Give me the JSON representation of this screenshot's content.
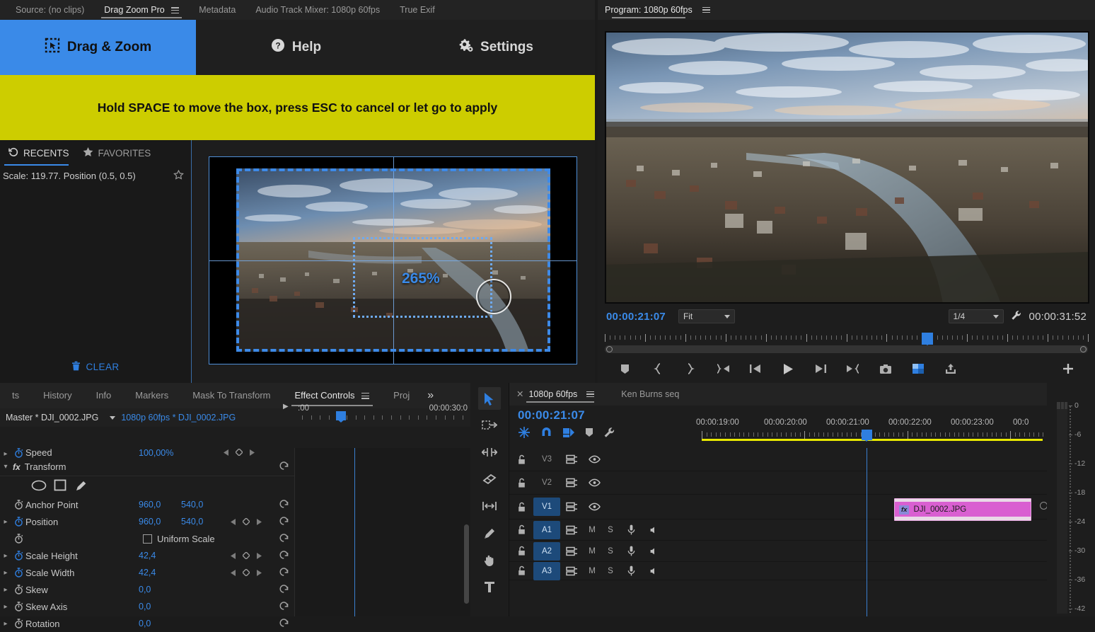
{
  "extension": {
    "tabs": [
      {
        "label": "Source: (no clips)",
        "active": false,
        "menu": false
      },
      {
        "label": "Drag Zoom Pro",
        "active": true,
        "menu": true
      },
      {
        "label": "Metadata",
        "active": false,
        "menu": false
      },
      {
        "label": "Audio Track Mixer: 1080p 60fps",
        "active": false,
        "menu": false
      },
      {
        "label": "True Exif",
        "active": false,
        "menu": false
      }
    ],
    "nav": [
      {
        "label": "Drag & Zoom",
        "icon": "drag-zoom-icon",
        "primary": true
      },
      {
        "label": "Help",
        "icon": "help-icon",
        "primary": false
      },
      {
        "label": "Settings",
        "icon": "gear-icon",
        "primary": false
      }
    ],
    "banner": "Hold SPACE to move the box, press ESC to cancel or let go to apply",
    "recents": {
      "tabs": [
        {
          "label": "RECENTS",
          "icon": "history-icon",
          "active": true
        },
        {
          "label": "FAVORITES",
          "icon": "star-icon",
          "active": false
        }
      ],
      "items": [
        {
          "text": "Scale: 119.77. Position (0.5, 0.5)",
          "favorite_icon": "star-outline-icon"
        }
      ],
      "clear_label": "CLEAR",
      "clear_icon": "trash-icon"
    },
    "stage": {
      "zoom_label": "265%",
      "cursor_icon": "arrow-cursor-icon"
    }
  },
  "program": {
    "tab_label": "Program: 1080p 60fps",
    "menu_icon": "hamburger-icon",
    "current_time": "00:00:21:07",
    "fit_value": "Fit",
    "quality_value": "1/4",
    "wrench_icon": "wrench-icon",
    "duration": "00:00:31:52",
    "buttons": [
      {
        "name": "add-marker-button",
        "icon": "marker-icon"
      },
      {
        "name": "mark-in-button",
        "icon": "brace-left-icon"
      },
      {
        "name": "mark-out-button",
        "icon": "brace-right-icon"
      },
      {
        "name": "go-to-in-button",
        "icon": "go-to-in-icon"
      },
      {
        "name": "step-back-button",
        "icon": "step-back-icon"
      },
      {
        "name": "play-stop-button",
        "icon": "play-icon"
      },
      {
        "name": "step-forward-button",
        "icon": "step-forward-icon"
      },
      {
        "name": "go-to-out-button",
        "icon": "go-to-out-icon"
      },
      {
        "name": "export-frame-button",
        "icon": "camera-icon"
      },
      {
        "name": "comparison-view-button",
        "icon": "comparison-icon"
      },
      {
        "name": "export-button",
        "icon": "export-icon"
      },
      {
        "name": "button-editor-button",
        "icon": "plus-icon"
      }
    ]
  },
  "effect_controls": {
    "tabs": [
      {
        "label": "ts",
        "active": false
      },
      {
        "label": "History",
        "active": false
      },
      {
        "label": "Info",
        "active": false
      },
      {
        "label": "Markers",
        "active": false
      },
      {
        "label": "Mask To Transform",
        "active": false
      },
      {
        "label": "Effect Controls",
        "active": true,
        "menu": true
      },
      {
        "label": "Proj",
        "active": false
      }
    ],
    "overflow_icon": "chevron-double-right-icon",
    "master_label": "Master * DJI_0002.JPG",
    "sequence_label": "1080p 60fps * DJI_0002.JPG",
    "ruler_left": ":00",
    "ruler_right": "00:00:30:0",
    "effect_title": "Transform",
    "effect_fx_icon": "fx-icon",
    "shape_tools": [
      {
        "name": "ellipse-mask-tool",
        "icon": "ellipse-icon"
      },
      {
        "name": "rectangle-mask-tool",
        "icon": "rectangle-icon"
      },
      {
        "name": "pen-mask-tool",
        "icon": "pen-icon"
      }
    ],
    "properties": [
      {
        "label": "Speed",
        "value": "100,00%",
        "expandable": true,
        "keyframed": false,
        "nav": true,
        "partial": true
      },
      {
        "label": "Anchor Point",
        "value": "960,0",
        "value2": "540,0",
        "expandable": false,
        "keyframed": false,
        "nav": false
      },
      {
        "label": "Position",
        "value": "960,0",
        "value2": "540,0",
        "expandable": true,
        "keyframed": true,
        "nav": true
      },
      {
        "label": "Uniform Scale",
        "value": "",
        "checkbox": true,
        "expandable": false,
        "keyframed": false,
        "nav": false
      },
      {
        "label": "Scale Height",
        "value": "42,4",
        "expandable": true,
        "keyframed": true,
        "nav": true
      },
      {
        "label": "Scale Width",
        "value": "42,4",
        "expandable": true,
        "keyframed": true,
        "nav": true
      },
      {
        "label": "Skew",
        "value": "0,0",
        "expandable": true,
        "keyframed": false,
        "nav": false
      },
      {
        "label": "Skew Axis",
        "value": "0,0",
        "expandable": true,
        "keyframed": false,
        "nav": false
      },
      {
        "label": "Rotation",
        "value": "0,0",
        "expandable": true,
        "keyframed": false,
        "nav": false
      }
    ]
  },
  "tools": [
    {
      "name": "selection-tool",
      "icon": "arrow-cursor-icon",
      "active": true
    },
    {
      "name": "track-select-forward-tool",
      "icon": "track-select-icon",
      "active": false
    },
    {
      "name": "ripple-edit-tool",
      "icon": "ripple-edit-icon",
      "active": false
    },
    {
      "name": "rolling-edit-tool",
      "icon": "razor-icon",
      "active": false
    },
    {
      "name": "slip-tool",
      "icon": "slip-icon",
      "active": false
    },
    {
      "name": "pen-tool",
      "icon": "pen-icon",
      "active": false
    },
    {
      "name": "hand-tool",
      "icon": "hand-icon",
      "active": false
    },
    {
      "name": "type-tool",
      "icon": "type-icon",
      "active": false
    }
  ],
  "timeline": {
    "tabs": [
      {
        "label": "1080p 60fps",
        "active": true,
        "close": true,
        "menu": true
      },
      {
        "label": "Ken Burns seq",
        "active": false
      }
    ],
    "current_time": "00:00:21:07",
    "header_icons": [
      {
        "name": "nest-sequence-button",
        "icon": "nest-icon",
        "on": true
      },
      {
        "name": "snap-button",
        "icon": "magnet-icon",
        "on": true
      },
      {
        "name": "linked-selection-button",
        "icon": "linked-selection-icon",
        "on": true
      },
      {
        "name": "add-marker-button",
        "icon": "marker-icon",
        "on": false
      },
      {
        "name": "timeline-settings-button",
        "icon": "wrench-icon",
        "on": false
      }
    ],
    "ruler_labels": [
      "00:00:19:00",
      "00:00:20:00",
      "00:00:21:00",
      "00:00:22:00",
      "00:00:23:00",
      "00:0"
    ],
    "tracks": [
      {
        "name": "V3",
        "type": "video",
        "targeted": false,
        "lock_icon": "lock-open-icon",
        "sync_icon": "track-sync-icon",
        "eye_icon": "eye-icon",
        "clips": []
      },
      {
        "name": "V2",
        "type": "video",
        "targeted": false,
        "lock_icon": "lock-open-icon",
        "sync_icon": "track-sync-icon",
        "eye_icon": "eye-icon",
        "clips": []
      },
      {
        "name": "V1",
        "type": "video",
        "targeted": true,
        "lock_icon": "lock-open-icon",
        "sync_icon": "track-sync-icon",
        "eye_icon": "eye-icon",
        "clips": [
          {
            "label": "DJI_0002.JPG",
            "fx": "fx",
            "color": "#d95fd1"
          }
        ]
      },
      {
        "name": "A1",
        "type": "audio",
        "targeted": true,
        "lock_icon": "lock-open-icon",
        "sync_icon": "track-sync-icon",
        "mute": "M",
        "solo": "S",
        "mic_icon": "mic-icon",
        "speaker_icon": "speaker-icon",
        "clips": []
      },
      {
        "name": "A2",
        "type": "audio",
        "targeted": true,
        "lock_icon": "lock-open-icon",
        "sync_icon": "track-sync-icon",
        "mute": "M",
        "solo": "S",
        "mic_icon": "mic-icon",
        "speaker_icon": "speaker-icon",
        "clips": []
      },
      {
        "name": "A3",
        "type": "audio",
        "targeted": true,
        "lock_icon": "lock-open-icon",
        "sync_icon": "track-sync-icon",
        "mute": "M",
        "solo": "S",
        "mic_icon": "mic-icon",
        "speaker_icon": "speaker-icon",
        "clips": []
      }
    ]
  },
  "audio_meter": {
    "labels": [
      "0",
      "-6",
      "-12",
      "-18",
      "-24",
      "-30",
      "-36",
      "-42"
    ]
  },
  "colors": {
    "accent_blue": "#3a8ae8",
    "banner_yellow": "#cdcd00",
    "clip_magenta": "#d95fd1",
    "timeline_yellow": "#e8e800",
    "panel_bg": "#1d1d1d"
  }
}
